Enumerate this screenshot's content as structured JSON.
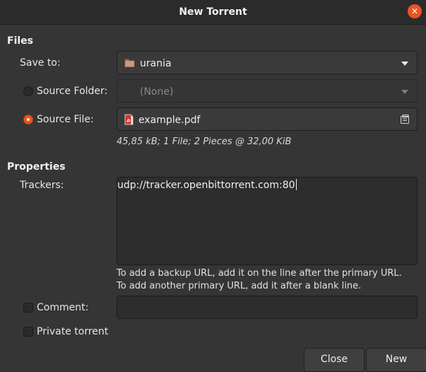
{
  "window": {
    "title": "New Torrent",
    "close_label": "✕"
  },
  "files": {
    "heading": "Files",
    "save_to_label": "Save to:",
    "save_to_value": "urania",
    "source_folder_label": "Source Folder:",
    "source_folder_value": "(None)",
    "source_file_label": "Source File:",
    "source_file_value": "example.pdf",
    "info": "45,85 kB; 1 File; 2 Pieces @ 32,00 KiB"
  },
  "properties": {
    "heading": "Properties",
    "trackers_label": "Trackers:",
    "trackers_value": "udp://tracker.openbittorrent.com:80",
    "hint_line1": "To add a backup URL, add it on the line after the primary URL.",
    "hint_line2": "To add another primary URL, add it after a blank line.",
    "comment_label": "Comment:",
    "comment_value": "",
    "private_label": "Private torrent"
  },
  "buttons": {
    "close": "Close",
    "new": "New"
  },
  "state": {
    "source_folder_selected": false,
    "source_file_selected": true,
    "comment_checked": false,
    "private_checked": false
  },
  "colors": {
    "accent": "#e95420",
    "background": "#353535",
    "titlebar": "#2b2b2b"
  }
}
